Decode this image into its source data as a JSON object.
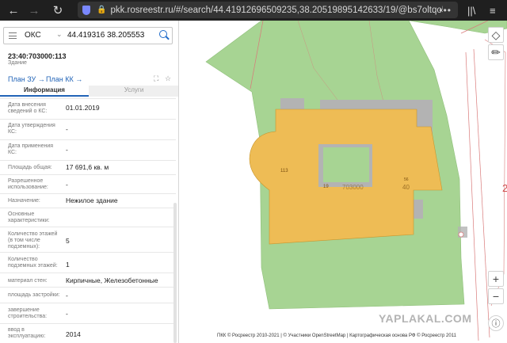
{
  "browser": {
    "url": "pkk.rosreestr.ru/#/search/44.41912696509235,38.20519895142633/19/@bs7oltqo5...",
    "more": "•••"
  },
  "search": {
    "type_label": "ОКС",
    "value": "44.419316 38.205553"
  },
  "object": {
    "cadastral_number": "23:40:703000:113",
    "type": "Здание"
  },
  "links": {
    "plan_zu": "План ЗУ",
    "plan_kk": "План КК"
  },
  "tabs": [
    {
      "label": "Информация",
      "active": true
    },
    {
      "label": "Услуги",
      "active": false
    }
  ],
  "info": [
    {
      "label": "Дата внесения сведений о КС:",
      "value": "01.01.2019"
    },
    {
      "label": "Дата утверждения КС:",
      "value": "-"
    },
    {
      "label": "Дата применения КС:",
      "value": "-"
    },
    {
      "label": "Площадь общая:",
      "value": "17 691,6 кв. м"
    },
    {
      "label": "Разрешенное использование:",
      "value": "-"
    },
    {
      "label": "Назначение:",
      "value": "Нежилое здание"
    },
    {
      "label": "Основные характеристики:",
      "value": ""
    },
    {
      "label": "Количество этажей (в том числе подземных):",
      "value": "5"
    },
    {
      "label": "Количество подземных этажей:",
      "value": "1"
    },
    {
      "label": "материал стен:",
      "value": "Кирпичные, Железобетонные"
    },
    {
      "label": "площадь застройки:",
      "value": "-"
    },
    {
      "label": "завершение строительства:",
      "value": "-"
    },
    {
      "label": "ввод в эксплуатацию:",
      "value": "2014"
    }
  ],
  "map": {
    "labels": {
      "l1": "113",
      "l2": "19",
      "l3": "703000",
      "l4": "40",
      "l5": "56",
      "l6": "2"
    },
    "controls": {
      "layers_icon": "layers-icon",
      "ruler_icon": "ruler-icon",
      "zoom_in": "+",
      "zoom_out": "−"
    },
    "attribution": "ПКК © Росреестр 2010-2021 | © Участники OpenStreetMap | Картографическая основа РФ © Росреестр 2011",
    "watermark": "YAPLAKAL.COM"
  },
  "colors": {
    "building": "#eebc55",
    "green_area": "#a7d493",
    "gray_block": "#b3b3b3",
    "accent": "#2264b7",
    "boundary_red": "#d97a7a"
  }
}
